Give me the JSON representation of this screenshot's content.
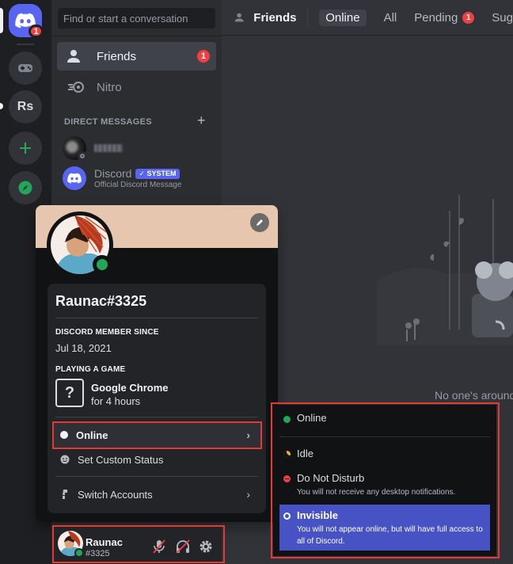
{
  "colors": {
    "blurple": "#5865f2",
    "online": "#23a55a",
    "idle": "#f0b232",
    "dnd": "#f23f42",
    "invisible": "#80848e",
    "highlight_box": "#e53935"
  },
  "servers": {
    "home_badge": "1",
    "items": [
      {
        "name": "server-1",
        "icon": "gamepad-icon"
      },
      {
        "name": "Rs",
        "label": "Rs"
      },
      {
        "name": "add-server",
        "icon": "plus-icon"
      },
      {
        "name": "explore",
        "icon": "compass-icon"
      }
    ]
  },
  "sidebar": {
    "search_placeholder": "Find or start a conversation",
    "friends_label": "Friends",
    "friends_badge": "1",
    "nitro_label": "Nitro",
    "dm_header": "DIRECT MESSAGES",
    "dms": [
      {
        "name": "",
        "avatar": "user-avatar"
      },
      {
        "name": "Discord",
        "badge": "SYSTEM",
        "subtitle": "Official Discord Message"
      }
    ]
  },
  "topbar": {
    "title": "Friends",
    "tabs": [
      {
        "label": "Online",
        "selected": true
      },
      {
        "label": "All"
      },
      {
        "label": "Pending",
        "badge": "1"
      },
      {
        "label": "Sug"
      }
    ]
  },
  "main": {
    "empty_text": "No one's around"
  },
  "profile": {
    "username": "Raunac",
    "discriminator": "#3325",
    "member_since_title": "DISCORD MEMBER SINCE",
    "member_since": "Jul 18, 2021",
    "activity_title": "PLAYING A GAME",
    "game_name": "Google Chrome",
    "game_duration": "for 4 hours",
    "status_label": "Online",
    "custom_status_label": "Set Custom Status",
    "switch_accounts_label": "Switch Accounts"
  },
  "status_menu": {
    "online": {
      "title": "Online"
    },
    "idle": {
      "title": "Idle"
    },
    "dnd": {
      "title": "Do Not Disturb",
      "desc": "You will not receive any desktop notifications."
    },
    "invisible": {
      "title": "Invisible",
      "desc": "You will not appear online, but will have full access to all of Discord.",
      "selected": true
    }
  },
  "userpanel": {
    "name": "Raunac",
    "tag": "#3325"
  }
}
